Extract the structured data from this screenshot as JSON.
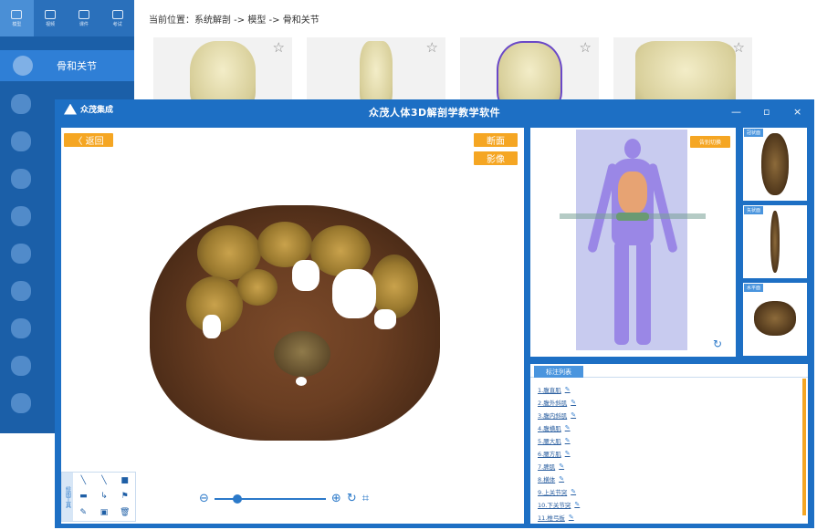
{
  "background_window": {
    "nav_tabs": [
      {
        "label": "模型",
        "active": true
      },
      {
        "label": "视频",
        "active": false
      },
      {
        "label": "课件",
        "active": false
      },
      {
        "label": "考试",
        "active": false
      }
    ],
    "active_item": "骨和关节",
    "breadcrumb": "当前位置：系统解剖 -> 模型 -> 骨和关节"
  },
  "main_window": {
    "logo_text": "众茂集成",
    "title": "众茂人体3D解剖学教学软件",
    "controls": {
      "minimize": "—",
      "maximize": "▫",
      "close": "×"
    }
  },
  "viewer": {
    "back_label": "〈 返回",
    "section_label": "断面",
    "image_label": "影像",
    "tools_label": "绘图工具"
  },
  "model_panel": {
    "switch_label": "告别切换"
  },
  "side_thumbs": [
    {
      "tag": "冠状面"
    },
    {
      "tag": "矢状面"
    },
    {
      "tag": "水平面"
    }
  ],
  "annotation": {
    "tab_label": "标注列表",
    "items": [
      "1.腹直肌",
      "2.腹外斜肌",
      "3.腹内斜肌",
      "4.腹横肌",
      "5.腰大肌",
      "6.腰方肌",
      "7.脾肌",
      "8.横体",
      "9.上关节突",
      "10.下关节突",
      "11.椎弓板"
    ]
  },
  "colors": {
    "brand_blue": "#1d6fc4",
    "accent_orange": "#f5a623",
    "model_purple": "#9a87e6"
  }
}
